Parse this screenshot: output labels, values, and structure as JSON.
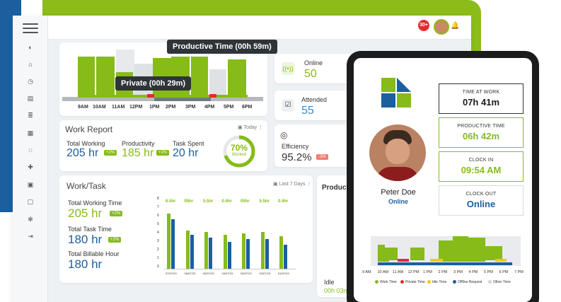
{
  "topbar": {
    "notification_count": "30+"
  },
  "productive_chart": {
    "tooltip_productive": "Productive Time (00h 59m)",
    "tooltip_private": "Private (00h 29m)",
    "hours": [
      "9AM",
      "10AM",
      "11AM",
      "12PM",
      "1PM",
      "2PM",
      "3PM",
      "4PM",
      "5PM",
      "6PM"
    ]
  },
  "stats": {
    "online": {
      "label": "Online",
      "value": "50"
    },
    "attended": {
      "label": "Attended",
      "value": "55"
    },
    "efficiency": {
      "label": "Efficiency",
      "value": "95.2%",
      "badge": "-3%"
    }
  },
  "work_report": {
    "title": "Work Report",
    "filter": "Today",
    "total_working_label": "Total Working",
    "total_working_value": "205 hr",
    "total_working_badge": "+2%",
    "productivity_label": "Productivity",
    "productivity_value": "185 hr",
    "productivity_badge": "+2%",
    "task_spent_label": "Task Spent",
    "task_spent_value": "20 hr",
    "ring_value": "70%",
    "ring_label": "Worked"
  },
  "work_task": {
    "title": "Work/Task",
    "filter": "Last 7 Days",
    "total_working_time_label": "Total Working Time",
    "total_working_time_value": "205 hr",
    "total_working_time_badge": "+2%",
    "total_task_time_label": "Total Task Time",
    "total_task_time_value": "180 hr",
    "total_task_time_badge": "+2%",
    "total_billable_label": "Total Billable Hour",
    "total_billable_value": "180 hr",
    "y_ticks": [
      "8",
      "7",
      "6",
      "5",
      "4",
      "3",
      "2",
      "1",
      "0"
    ],
    "bar_top_labels": [
      "6.5hr",
      "05hr",
      "5.5hr",
      "0.4hr",
      "05hr",
      "5.5hr",
      "0.4hr"
    ],
    "dates": [
      "07/07/23",
      "06/07/23",
      "05/07/23",
      "04/07/23",
      "03/07/23",
      "02/07/23",
      "01/07/23"
    ]
  },
  "productivity_card": {
    "title": "Productive",
    "idle_label": "Idle",
    "idle_value": "00h 03m"
  },
  "phone": {
    "name": "Peter Doe",
    "status": "Online",
    "time_at_work_label": "TIME AT WORK",
    "time_at_work_value": "07h 41m",
    "productive_time_label": "PRODUCTIVE TIME",
    "productive_time_value": "06h 42m",
    "clock_in_label": "CLOCK IN",
    "clock_in_value": "09:54 AM",
    "clock_out_label": "CLOCK OUT",
    "clock_out_value": "Online",
    "hours": [
      "9 AM",
      "10 AM",
      "11 AM",
      "12 PM",
      "1 PM",
      "2 PM",
      "3 PM",
      "4 PM",
      "5 PM",
      "6 PM",
      "7 PM"
    ],
    "legend": [
      "Work Time",
      "Private Time",
      "Idle Time",
      "Offline Request",
      "Other Time"
    ],
    "legend_colors": [
      "#86bb1a",
      "#e02d2d",
      "#f2c81e",
      "#1b5f9e",
      "#cfd3d8"
    ]
  }
}
